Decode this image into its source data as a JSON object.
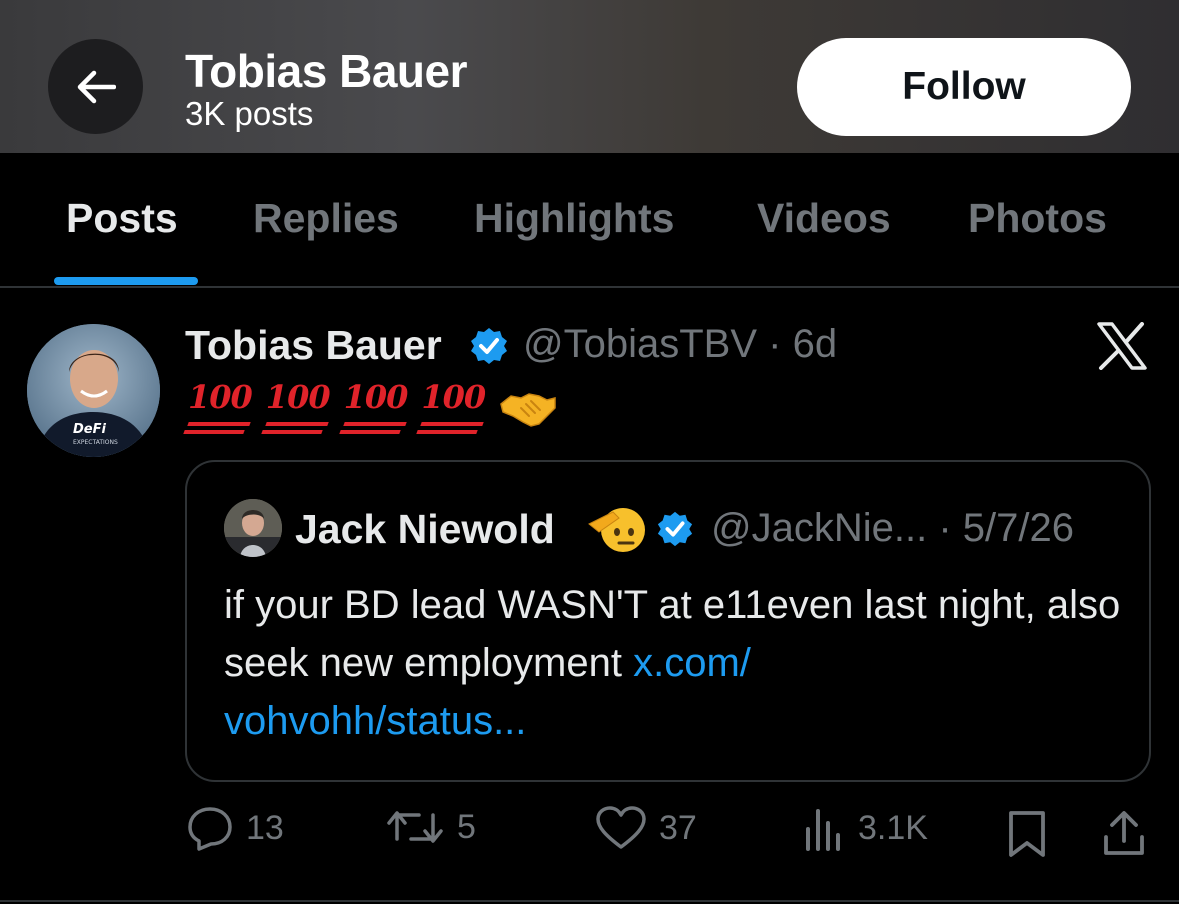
{
  "header": {
    "title": "Tobias Bauer",
    "subtitle": "3K posts",
    "follow_label": "Follow",
    "back_icon": "arrow-left-icon"
  },
  "tabs": [
    {
      "label": "Posts",
      "active": true
    },
    {
      "label": "Replies",
      "active": false
    },
    {
      "label": "Highlights",
      "active": false
    },
    {
      "label": "Videos",
      "active": false
    },
    {
      "label": "Photos",
      "active": false
    }
  ],
  "post": {
    "author_name": "Tobias Bauer",
    "handle_time": "@TobiasTBV · 6d",
    "hundred_emoji": "100",
    "avatar_shirt_line1": "DeFi",
    "avatar_shirt_line2": "EXPECTATIONS",
    "quote": {
      "author_name": "Jack Niewold",
      "handle_date": "@JackNie... · 5/7/26",
      "text": "if your BD lead WASN'T at e11even last night, also seek new employment ",
      "link_part1": "x.com/",
      "link_part2": "vohvohh/status..."
    },
    "actions": {
      "replies": "13",
      "reposts": "5",
      "likes": "37",
      "views": "3.1K"
    }
  },
  "colors": {
    "accent": "#1d9bf0",
    "muted": "#71767b",
    "text": "#e7e9ea",
    "border": "#2f3336"
  }
}
